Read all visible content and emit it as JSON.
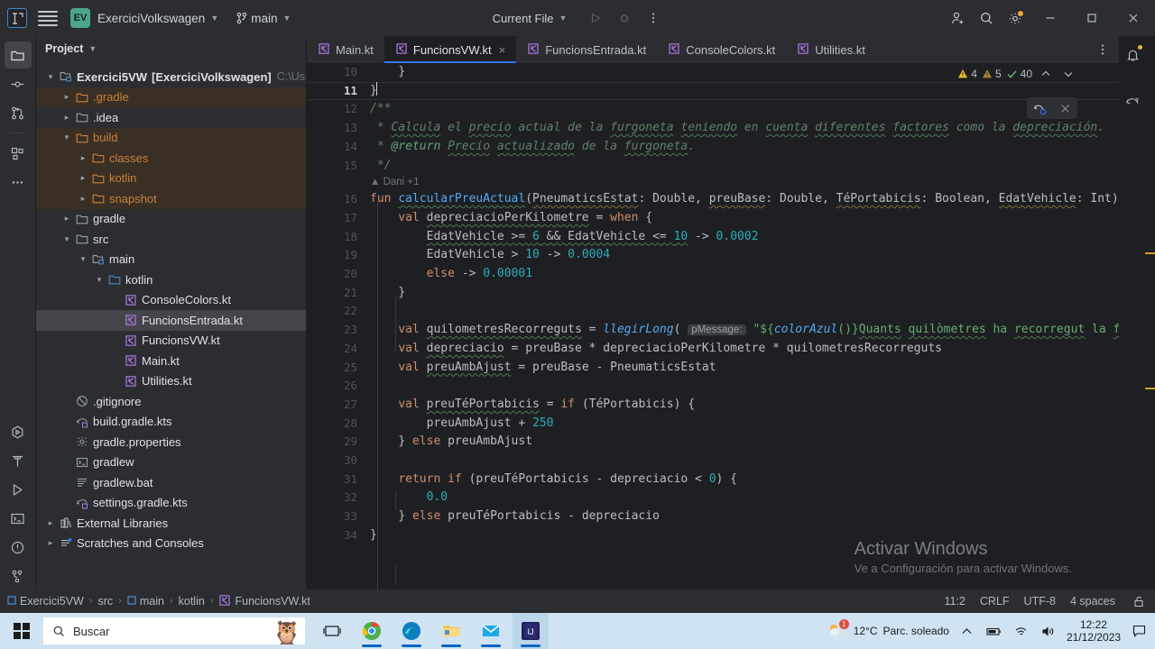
{
  "titlebar": {
    "logo_text": "IJ",
    "project_badge": "EV",
    "project_name": "ExerciciVolkswagen",
    "branch": "main",
    "run_config": "Current File",
    "icons": [
      "hamburger-icon",
      "chevron-down-icon",
      "branch-icon",
      "run-icon",
      "debug-icon",
      "more-icon",
      "add-user-icon",
      "search-icon",
      "settings-icon",
      "minimize-icon",
      "maximize-icon",
      "close-icon"
    ]
  },
  "stripe": {
    "top": [
      "project-icon",
      "commit-icon",
      "pull-requests-icon",
      "structure-icon",
      "more-tool-windows-icon"
    ],
    "bottom": [
      "run-anything-icon",
      "build-icon",
      "run-icon",
      "terminal-icon",
      "problems-icon",
      "git-icon"
    ]
  },
  "project_panel": {
    "title": "Project",
    "tree": [
      {
        "label": "Exercici5VW",
        "suffix": "[ExerciciVolkswagen]",
        "path": "C:\\Use",
        "depth": 0,
        "arrow": "expanded",
        "icon": "module-icon",
        "state": "normal",
        "bold": true
      },
      {
        "label": ".gradle",
        "depth": 1,
        "arrow": "collapsed",
        "icon": "folder-icon",
        "state": "excluded"
      },
      {
        "label": ".idea",
        "depth": 1,
        "arrow": "collapsed",
        "icon": "folder-icon",
        "state": "normal"
      },
      {
        "label": "build",
        "depth": 1,
        "arrow": "expanded",
        "icon": "folder-icon",
        "state": "excluded"
      },
      {
        "label": "classes",
        "depth": 2,
        "arrow": "collapsed",
        "icon": "folder-icon",
        "state": "excluded"
      },
      {
        "label": "kotlin",
        "depth": 2,
        "arrow": "collapsed",
        "icon": "folder-icon",
        "state": "excluded"
      },
      {
        "label": "snapshot",
        "depth": 2,
        "arrow": "collapsed",
        "icon": "folder-icon",
        "state": "excluded"
      },
      {
        "label": "gradle",
        "depth": 1,
        "arrow": "collapsed",
        "icon": "folder-icon",
        "state": "normal"
      },
      {
        "label": "src",
        "depth": 1,
        "arrow": "expanded",
        "icon": "folder-icon",
        "state": "normal"
      },
      {
        "label": "main",
        "depth": 2,
        "arrow": "expanded",
        "icon": "module-icon",
        "state": "normal"
      },
      {
        "label": "kotlin",
        "depth": 3,
        "arrow": "expanded",
        "icon": "source-folder-icon",
        "state": "source"
      },
      {
        "label": "ConsoleColors.kt",
        "depth": 4,
        "arrow": "none",
        "icon": "kotlin-file-icon",
        "state": "normal"
      },
      {
        "label": "FuncionsEntrada.kt",
        "depth": 4,
        "arrow": "none",
        "icon": "kotlin-file-icon",
        "state": "selected"
      },
      {
        "label": "FuncionsVW.kt",
        "depth": 4,
        "arrow": "none",
        "icon": "kotlin-file-icon",
        "state": "normal"
      },
      {
        "label": "Main.kt",
        "depth": 4,
        "arrow": "none",
        "icon": "kotlin-file-icon",
        "state": "normal"
      },
      {
        "label": "Utilities.kt",
        "depth": 4,
        "arrow": "none",
        "icon": "kotlin-file-icon",
        "state": "normal"
      },
      {
        "label": ".gitignore",
        "depth": 1,
        "arrow": "none",
        "icon": "gitignore-icon",
        "state": "normal"
      },
      {
        "label": "build.gradle.kts",
        "depth": 1,
        "arrow": "none",
        "icon": "gradle-kts-icon",
        "state": "normal"
      },
      {
        "label": "gradle.properties",
        "depth": 1,
        "arrow": "none",
        "icon": "properties-icon",
        "state": "normal"
      },
      {
        "label": "gradlew",
        "depth": 1,
        "arrow": "none",
        "icon": "shell-script-icon",
        "state": "normal"
      },
      {
        "label": "gradlew.bat",
        "depth": 1,
        "arrow": "none",
        "icon": "text-file-icon",
        "state": "normal"
      },
      {
        "label": "settings.gradle.kts",
        "depth": 1,
        "arrow": "none",
        "icon": "gradle-kts-icon",
        "state": "normal"
      },
      {
        "label": "External Libraries",
        "depth": 0,
        "arrow": "collapsed",
        "icon": "libraries-icon",
        "state": "normal"
      },
      {
        "label": "Scratches and Consoles",
        "depth": 0,
        "arrow": "collapsed",
        "icon": "scratches-icon",
        "state": "normal"
      }
    ]
  },
  "editor": {
    "tabs": [
      {
        "label": "Main.kt",
        "active": false,
        "closable": false
      },
      {
        "label": "FuncionsVW.kt",
        "active": true,
        "closable": true
      },
      {
        "label": "FuncionsEntrada.kt",
        "active": false,
        "closable": false
      },
      {
        "label": "ConsoleColors.kt",
        "active": false,
        "closable": false
      },
      {
        "label": "Utilities.kt",
        "active": false,
        "closable": false
      }
    ],
    "close_glyph": "×",
    "inspections": {
      "warnings_yellow": "4",
      "warnings_orange": "5",
      "ok_count": "40"
    },
    "first_line_number": 10,
    "current_line": 11,
    "annotation": "Dani +1",
    "lines": [
      {
        "n": 10,
        "html": "    <span class='pln'>}</span>"
      },
      {
        "n": 11,
        "current": true,
        "html": "<span class='pln'>}</span><span class='caret'></span>"
      },
      {
        "n": 12,
        "html": "<span class='cmt'>/**</span>"
      },
      {
        "n": 13,
        "html": "<span class='cmt'> * </span><span class='cmt sq'>Calcula</span><span class='cmt'> el </span><span class='cmt sq'>precio</span><span class='cmt'> actual de la </span><span class='cmt sq'>furgoneta</span><span class='cmt'> </span><span class='cmt sq'>teniendo</span><span class='cmt'> en </span><span class='cmt sq'>cuenta</span><span class='cmt'> </span><span class='cmt sq'>diferentes</span><span class='cmt'> </span><span class='cmt sq'>factores</span><span class='cmt'> como la </span><span class='cmt sq'>depreciación</span><span class='cmt'>.</span>"
      },
      {
        "n": 14,
        "html": "<span class='cmt'> * </span><span class='cmt-tag'>@return</span><span class='cmt'> </span><span class='cmt sq'>Precio</span><span class='cmt'> </span><span class='cmt sq'>actualizado</span><span class='cmt'> de la </span><span class='cmt sq'>furgoneta</span><span class='cmt'>.</span>"
      },
      {
        "n": 15,
        "html": "<span class='cmt'> */</span>"
      },
      {
        "n": 16,
        "html": "<span class='kw'>fun</span> <span class='fn sq'>calcularPreuActual</span><span class='pln'>(</span><span class='pln sq2'>PneumaticsEstat</span><span class='pln'>: Double, </span><span class='pln sq2'>preuBase</span><span class='pln'>: Double, </span><span class='pln sq2'>TéPortabicis</span><span class='pln'>: Boolean, </span><span class='pln sq2'>EdatVehicle</span><span class='pln'>: Int): Do</span>"
      },
      {
        "n": 17,
        "html": "    <span class='kw'>val</span> <span class='pln sq'>depreciacioPerKilometre</span> <span class='pln'>= </span><span class='kw'>when</span> <span class='pln'>{</span>"
      },
      {
        "n": 18,
        "html": "        <span class='pln sq'>EdatVehicle &gt;= </span><span class='num sq'>6</span><span class='pln sq'> &amp;&amp; EdatVehicle &lt;= </span><span class='num sq'>10</span><span class='pln'> -&gt; </span><span class='num'>0.0002</span>"
      },
      {
        "n": 19,
        "html": "        <span class='pln'>EdatVehicle &gt; </span><span class='num'>10</span><span class='pln'> -&gt; </span><span class='num'>0.0004</span>"
      },
      {
        "n": 20,
        "html": "        <span class='kw'>else</span><span class='pln'> -&gt; </span><span class='num'>0.00001</span>"
      },
      {
        "n": 21,
        "html": "    <span class='pln'>}</span>"
      },
      {
        "n": 22,
        "html": ""
      },
      {
        "n": 23,
        "html": "    <span class='kw'>val</span> <span class='pln sq'>quilometresRecorreguts</span> <span class='pln'>= </span><span class='fn ital'>llegirLong</span><span class='pln'>( </span><span class='inlay'>pMessage:</span> <span class='str'>\"${</span><span class='fn ital'>colorAzul</span><span class='str'>()}</span><span class='str sq'>Quants</span><span class='str'> </span><span class='str sq'>quilòmetres</span><span class='str'> ha </span><span class='str sq'>recorregut</span><span class='str'> la </span><span class='str sq'>furgo</span>"
      },
      {
        "n": 24,
        "html": "    <span class='kw'>val</span> <span class='pln sq'>depreciacio</span> <span class='pln'>= preuBase * depreciacioPerKilometre * quilometresRecorreguts</span>"
      },
      {
        "n": 25,
        "html": "    <span class='kw'>val</span> <span class='pln sq'>preuAmbAjust</span> <span class='pln'>= preuBase - PneumaticsEstat</span>"
      },
      {
        "n": 26,
        "html": ""
      },
      {
        "n": 27,
        "html": "    <span class='kw'>val</span> <span class='pln sq'>preuTéPortabicis</span> <span class='pln'>= </span><span class='kw'>if</span><span class='pln'> (TéPortabicis) {</span>"
      },
      {
        "n": 28,
        "html": "        <span class='pln'>preuAmbAjust + </span><span class='num'>250</span>"
      },
      {
        "n": 29,
        "html": "    <span class='pln'>} </span><span class='kw'>else</span><span class='pln'> preuAmbAjust</span>"
      },
      {
        "n": 30,
        "html": ""
      },
      {
        "n": 31,
        "html": "    <span class='kw'>return</span> <span class='kw'>if</span><span class='pln'> (preuTéPortabicis - depreciacio &lt; </span><span class='num'>0</span><span class='pln'>) {</span>"
      },
      {
        "n": 32,
        "html": "        <span class='num'>0.0</span>"
      },
      {
        "n": 33,
        "html": "    <span class='pln'>} </span><span class='kw'>else</span><span class='pln'> preuTéPortabicis - depreciacio</span>"
      },
      {
        "n": 34,
        "html": "<span class='pln'>}</span>"
      }
    ]
  },
  "watermark": {
    "line1": "Activar Windows",
    "line2": "Ve a Configuración para activar Windows."
  },
  "status_bar": {
    "breadcrumb": [
      "Exercici5VW",
      "src",
      "main",
      "kotlin",
      "FuncionsVW.kt"
    ],
    "caret_position": "11:2",
    "line_separator": "CRLF",
    "encoding": "UTF-8",
    "indent": "4 spaces",
    "lock_icon": "unlocked-icon"
  },
  "taskbar": {
    "search_placeholder": "Buscar",
    "apps": [
      "task-view-icon",
      "chrome-icon",
      "edge-icon",
      "file-explorer-icon",
      "mail-icon",
      "intellij-icon"
    ],
    "weather_temp": "12°C",
    "weather_desc": "Parc. soleado",
    "weather_badge": "1",
    "tray_icons": [
      "show-hidden-icons-icon",
      "battery-icon",
      "wifi-icon",
      "volume-icon",
      "notifications-icon"
    ],
    "time": "12:22",
    "date": "21/12/2023"
  },
  "colors": {
    "accent": "#3574f0",
    "excluded_folder": "#c9803c",
    "kotlin_purple": "#b07ce8",
    "badge_green": "#4ca58a",
    "warning_yellow": "#e8b931",
    "ok_green": "#5fad65"
  }
}
